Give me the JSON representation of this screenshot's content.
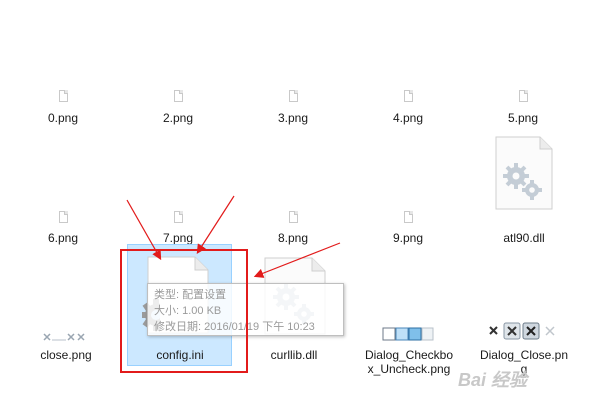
{
  "files": [
    {
      "name": "0.png"
    },
    {
      "name": "2.png"
    },
    {
      "name": "3.png"
    },
    {
      "name": "4.png"
    },
    {
      "name": "5.png"
    },
    {
      "name": "6.png"
    },
    {
      "name": "7.png"
    },
    {
      "name": "8.png"
    },
    {
      "name": "9.png"
    },
    {
      "name": "atl90.dll"
    },
    {
      "name": "close.png"
    },
    {
      "name": "config.ini"
    },
    {
      "name": "curllib.dll"
    },
    {
      "name": "Dialog_Checkbox_Uncheck.png"
    },
    {
      "name": "Dialog_Close.png"
    }
  ],
  "tooltip": {
    "type": "类型: 配置设置",
    "size": "大小: 1.00 KB",
    "modified": "修改日期: 2016/01/19 下午 10:23"
  },
  "watermark": "Bai 经验",
  "colors": {
    "selection": "#cce8ff",
    "annotation": "#e21b1b"
  }
}
